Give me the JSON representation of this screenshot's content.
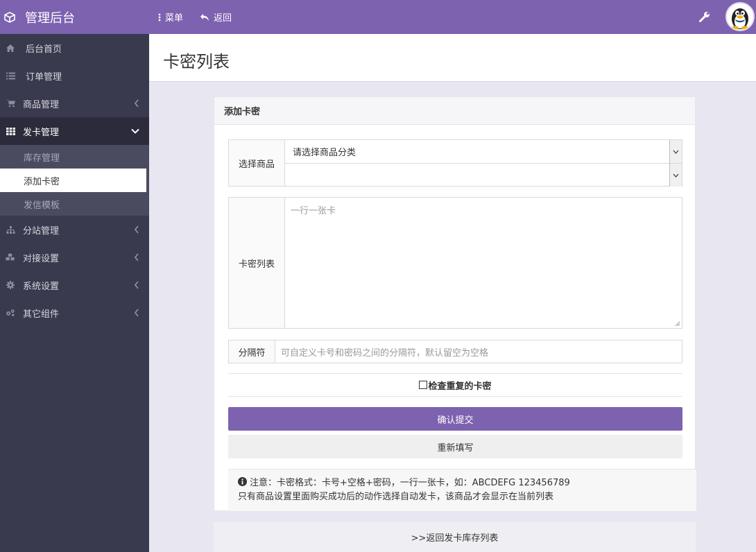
{
  "brand": {
    "title": "管理后台",
    "icon": "cube-icon"
  },
  "topnav": {
    "menu_label": "菜单",
    "back_label": "返回",
    "tools_icon": "wrench-icon",
    "avatar": "qq-penguin-avatar"
  },
  "colors": {
    "accent": "#7d62b0",
    "sidebar": "#393a4d",
    "sidebar_active": "#2b2b3b",
    "submenu": "#4b4b60"
  },
  "sidebar": {
    "items": [
      {
        "label": "后台首页",
        "icon": "home-icon"
      },
      {
        "label": "订单管理",
        "icon": "list-icon"
      },
      {
        "label": "商品管理",
        "icon": "cart-icon"
      },
      {
        "label": "发卡管理",
        "icon": "grid-icon"
      },
      {
        "label": "分站管理",
        "icon": "sitemap-icon"
      },
      {
        "label": "对接设置",
        "icon": "cubes-icon"
      },
      {
        "label": "系统设置",
        "icon": "gear-icon"
      },
      {
        "label": "其它组件",
        "icon": "gears-icon"
      }
    ],
    "sub": [
      "库存管理",
      "添加卡密",
      "发信模板"
    ]
  },
  "page": {
    "title": "卡密列表"
  },
  "panel": {
    "title": "添加卡密",
    "select_label": "选择商品",
    "category_value": "请选择商品分类",
    "product_value": "",
    "cards_label": "卡密列表",
    "cards_placeholder": "一行一张卡",
    "sep_label": "分隔符",
    "sep_placeholder": "可自定义卡号和密码之间的分隔符，默认留空为空格",
    "check_label": "检查重复的卡密",
    "submit_label": "确认提交",
    "reset_label": "重新填写",
    "note_line1": "注意：卡密格式：卡号+空格+密码，一行一张卡，如：ABCDEFG 123456789",
    "note_line2": "只有商品设置里面购买成功后的动作选择自动发卡，该商品才会显示在当前列表"
  },
  "footer": {
    "back_link": ">>返回发卡库存列表"
  }
}
